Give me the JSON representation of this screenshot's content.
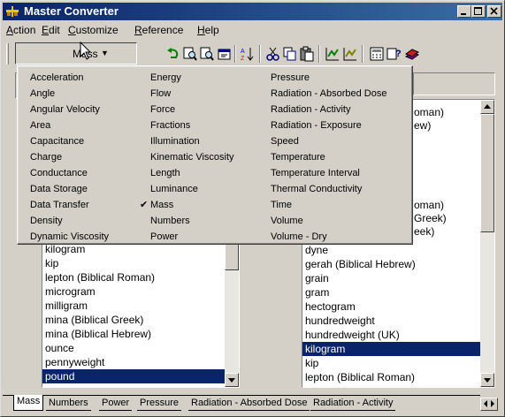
{
  "window": {
    "title": "Master Converter"
  },
  "menu": [
    "Action",
    "Edit",
    "Customize",
    "Reference",
    "Help"
  ],
  "menu_underline": [
    "A",
    "E",
    "C",
    "R",
    "H"
  ],
  "toolbar": {
    "category_value": "Mass",
    "icons": [
      "undo-icon",
      "find-icon",
      "find-next-icon",
      "properties-icon",
      "sort-icon",
      "cut-icon",
      "copy-icon",
      "paste-icon",
      "chart-icon",
      "chart-alt-icon",
      "calculator-icon",
      "help-icon",
      "book-icon"
    ]
  },
  "dropdown": {
    "col1": [
      "Acceleration",
      "Angle",
      "Angular Velocity",
      "Area",
      "Capacitance",
      "Charge",
      "Conductance",
      "Data Storage",
      "Data Transfer",
      "Density",
      "Dynamic Viscosity"
    ],
    "col2": [
      "Energy",
      "Flow",
      "Force",
      "Fractions",
      "Illumination",
      "Kinematic Viscosity",
      "Length",
      "Luminance",
      "Mass",
      "Numbers",
      "Power"
    ],
    "col3": [
      "Pressure",
      "Radiation - Absorbed Dose",
      "Radiation - Activity",
      "Radiation - Exposure",
      "Speed",
      "Temperature",
      "Temperature Interval",
      "Thermal Conductivity",
      "Time",
      "Volume",
      "Volume - Dry"
    ],
    "checked": "Mass"
  },
  "left_list": {
    "items": [
      "kilogram",
      "kip",
      "lepton (Biblical Roman)",
      "microgram",
      "milligram",
      "mina (Biblical Greek)",
      "mina (Biblical Hebrew)",
      "ounce",
      "pennyweight",
      "pound"
    ],
    "selected": "pound"
  },
  "right_list": {
    "partial_items": [
      "oman)",
      "ew)",
      "",
      "",
      "",
      "",
      "",
      "oman)",
      "Greek)",
      "eek)"
    ],
    "items": [
      "dyne",
      "gerah (Biblical Hebrew)",
      "grain",
      "gram",
      "hectogram",
      "hundredweight",
      "hundredweight (UK)",
      "kilogram",
      "kip",
      "lepton (Biblical Roman)"
    ],
    "selected": "kilogram"
  },
  "tabs": [
    "Mass",
    "Numbers",
    "Power",
    "Pressure",
    "Radiation - Absorbed Dose",
    "Radiation - Activity"
  ],
  "active_tab": "Mass",
  "colors": {
    "title_bar": "#0a246a",
    "selection": "#0a246a",
    "face": "#d4d0c8"
  }
}
